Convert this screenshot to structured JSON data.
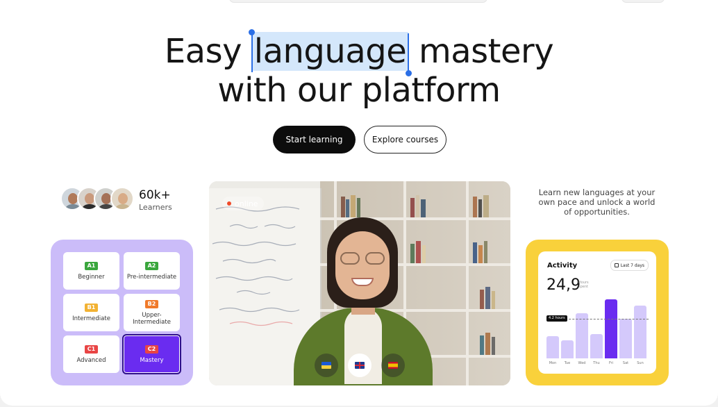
{
  "hero": {
    "line1_before": "Easy ",
    "line1_highlight": "language",
    "line1_after": " mastery",
    "line2": "with our platform"
  },
  "actions": {
    "primary": "Start learning",
    "secondary": "Explore courses"
  },
  "learners": {
    "count": "60k+",
    "label": "Learners"
  },
  "levels": [
    {
      "code": "A1",
      "name": "Beginner",
      "color": "#3aa63d"
    },
    {
      "code": "A2",
      "name": "Pre-intermediate",
      "color": "#3aa63d"
    },
    {
      "code": "B1",
      "name": "Intermediate",
      "color": "#f2b233"
    },
    {
      "code": "B2",
      "name": "Upper-Intermediate",
      "color": "#f07a2a"
    },
    {
      "code": "C1",
      "name": "Advanced",
      "color": "#e94545"
    },
    {
      "code": "C2",
      "name": "Mastery",
      "color": "#e94545"
    }
  ],
  "selected_level": "C2",
  "video": {
    "status": "online",
    "language_flags": [
      "ukraine-flag-icon",
      "uk-flag-icon",
      "spain-flag-icon"
    ],
    "selected_flag": "uk-flag-icon"
  },
  "tagline": "Learn new languages at your own pace and unlock a world of opportunities.",
  "activity": {
    "title": "Activity",
    "range": "Last 7 days",
    "total": "24,9",
    "unit": "Hours spent",
    "reference_label": "4.2 hours",
    "chart_data": {
      "type": "bar",
      "categories": [
        "Mon",
        "Tue",
        "Wed",
        "Thu",
        "Fri",
        "Sat",
        "Sun"
      ],
      "values": [
        2.4,
        1.9,
        4.8,
        2.6,
        6.3,
        4.2,
        5.6
      ],
      "highlight": "Fri",
      "reference": 4.2
    }
  },
  "colors": {
    "accent_purple": "#6a2cf0",
    "levels_bg": "#cbbcf9",
    "activity_bg": "#f9d13b",
    "selection": "#d4e7fb"
  }
}
